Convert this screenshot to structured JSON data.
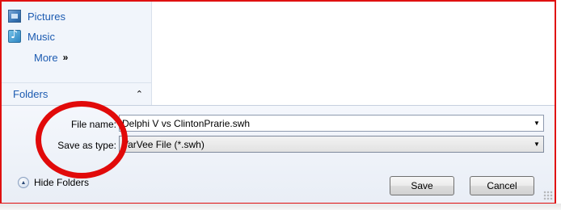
{
  "nav": {
    "items": [
      {
        "label": "Pictures",
        "icon": "pictures-icon"
      },
      {
        "label": "Music",
        "icon": "music-icon"
      }
    ],
    "more_label": "More",
    "more_chevron": "»",
    "folders_label": "Folders",
    "folders_caret": "⌃"
  },
  "form": {
    "file_name_label": "File name:",
    "file_name_value": "Delphi V vs ClintonPrarie.swh",
    "save_as_type_label": "Save as type:",
    "save_as_type_value": "VarVee File (*.swh)"
  },
  "footer": {
    "hide_folders_label": "Hide Folders",
    "save_label": "Save",
    "cancel_label": "Cancel"
  },
  "colors": {
    "annotation": "#e10a0a",
    "link": "#1c5bb1"
  }
}
